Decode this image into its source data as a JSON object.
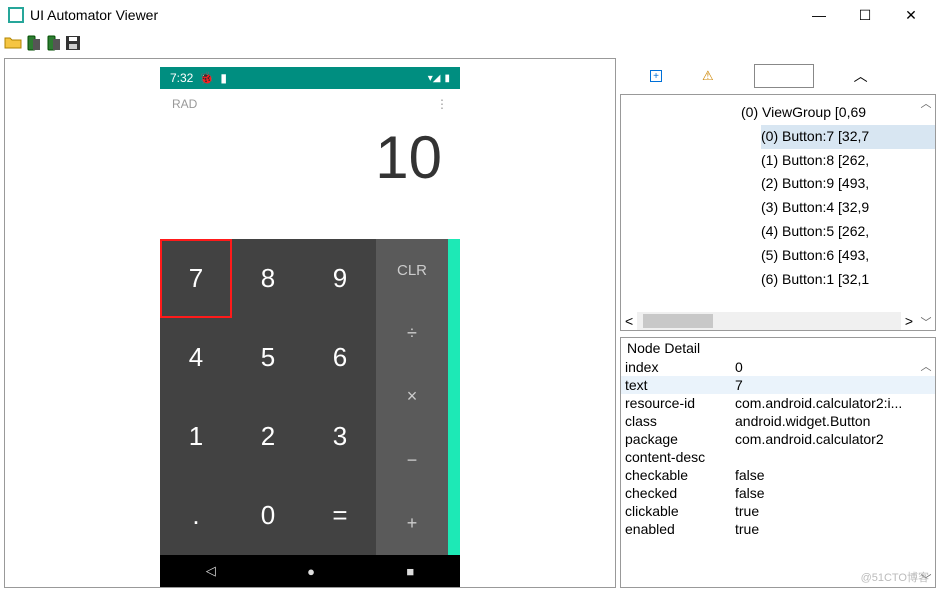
{
  "window": {
    "title": "UI Automator Viewer",
    "minimize": "—",
    "maximize": "☐",
    "close": "✕"
  },
  "device": {
    "statusTime": "7:32",
    "radLabel": "RAD",
    "displayValue": "10",
    "keys": {
      "k7": "7",
      "k8": "8",
      "k9": "9",
      "k4": "4",
      "k5": "5",
      "k6": "6",
      "k1": "1",
      "k2": "2",
      "k3": "3",
      "kdot": ".",
      "k0": "0",
      "keq": "="
    },
    "ops": {
      "clr": "CLR",
      "div": "÷",
      "mul": "×",
      "sub": "−",
      "add": "+"
    }
  },
  "tree": {
    "rows": [
      "(0) ViewGroup [0,69",
      "(0) Button:7 [32,7",
      "(1) Button:8 [262,",
      "(2) Button:9 [493,",
      "(3) Button:4 [32,9",
      "(4) Button:5 [262,",
      "(5) Button:6 [493,",
      "(6) Button:1 [32,1"
    ],
    "selectedIndex": 1
  },
  "detail": {
    "title": "Node Detail",
    "rows": [
      {
        "k": "index",
        "v": "0"
      },
      {
        "k": "text",
        "v": "7"
      },
      {
        "k": "resource-id",
        "v": "com.android.calculator2:i..."
      },
      {
        "k": "class",
        "v": "android.widget.Button"
      },
      {
        "k": "package",
        "v": "com.android.calculator2"
      },
      {
        "k": "content-desc",
        "v": ""
      },
      {
        "k": "checkable",
        "v": "false"
      },
      {
        "k": "checked",
        "v": "false"
      },
      {
        "k": "clickable",
        "v": "true"
      },
      {
        "k": "enabled",
        "v": "true"
      }
    ],
    "highlightIndex": 1
  },
  "watermark": "@51CTO博客"
}
